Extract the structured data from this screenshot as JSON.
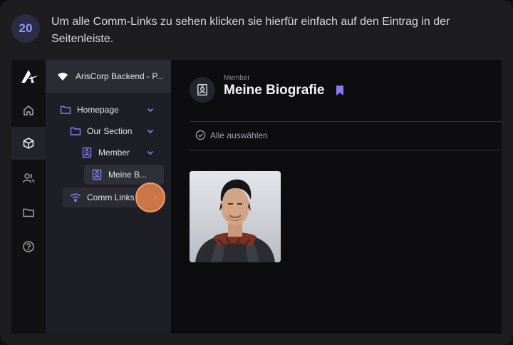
{
  "step": {
    "number": "20",
    "text": "Um alle Comm-Links zu sehen klicken sie hierfür einfach auf den Eintrag in der Seitenleiste."
  },
  "sidebar_rail": {
    "icons": [
      "logo-icon",
      "home-icon",
      "cube-icon",
      "users-icon",
      "folder-icon",
      "help-icon"
    ],
    "active": "cube-icon"
  },
  "tree": {
    "header": "ArisCorp Backend - P...",
    "items": [
      {
        "label": "Homepage",
        "icon": "folder-icon",
        "expanded": true
      },
      {
        "label": "Our Section",
        "icon": "folder-icon",
        "expanded": true
      },
      {
        "label": "Member",
        "icon": "id-badge-icon",
        "expanded": true
      },
      {
        "label": "Meine B...",
        "icon": "id-badge-icon",
        "selected": true
      },
      {
        "label": "Comm Links",
        "icon": "wifi-icon",
        "expanded": false
      }
    ]
  },
  "main": {
    "subtitle": "Member",
    "title": "Meine Biografie",
    "select_all": "Alle auswählen"
  },
  "colors": {
    "accent": "#8b7cf6",
    "click_marker": "#e0814c",
    "badge_text": "#8f95ff"
  }
}
